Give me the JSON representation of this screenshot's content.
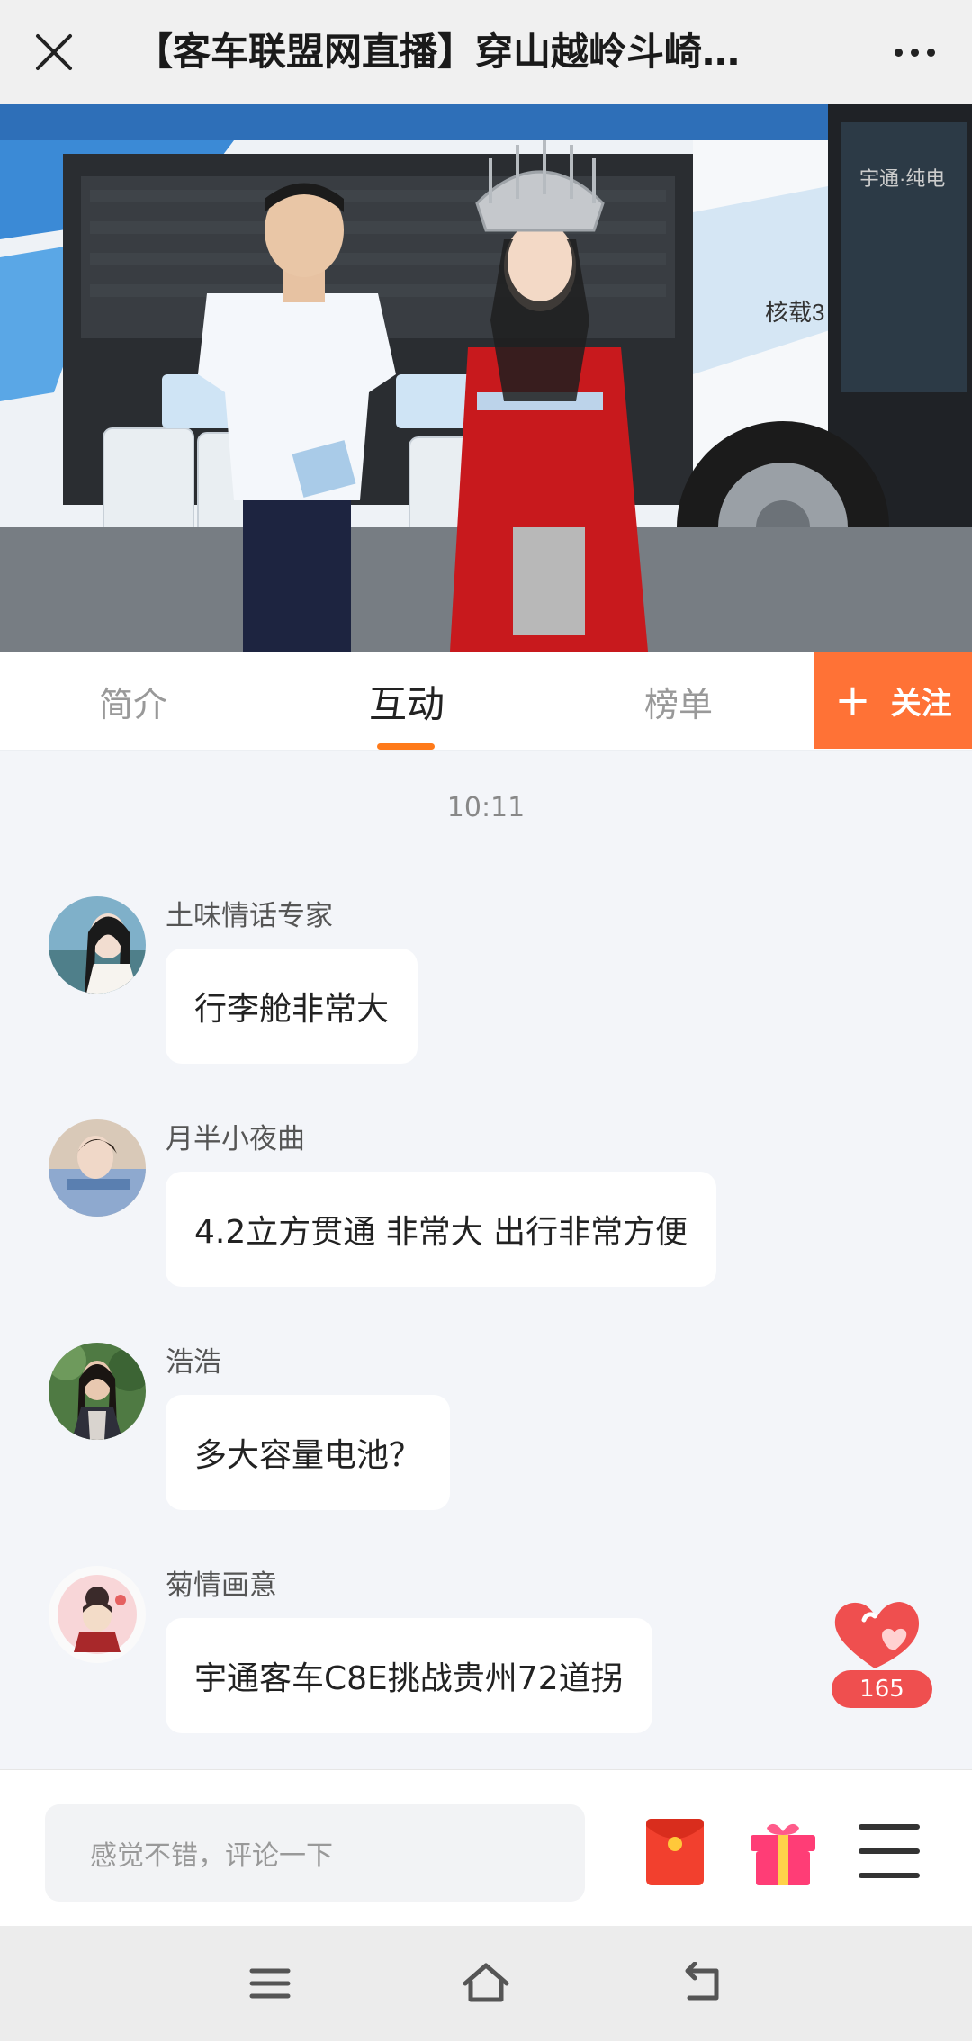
{
  "header": {
    "title": "【客车联盟网直播】穿山越岭斗崎…"
  },
  "tabs": [
    {
      "label": "简介",
      "active": false
    },
    {
      "label": "互动",
      "active": true
    },
    {
      "label": "榜单",
      "active": false
    }
  ],
  "follow_button": {
    "label": "关注",
    "color": "#ff7236"
  },
  "accent_color": "#ff7a1a",
  "chat": {
    "time": "10:11",
    "messages": [
      {
        "user": "土味情话专家",
        "text": "行李舱非常大",
        "avatar": "avatar-photo-woman"
      },
      {
        "user": "月半小夜曲",
        "text": "4.2立方贯通  非常大  出行非常方便",
        "avatar": "avatar-photo-woman"
      },
      {
        "user": "浩浩",
        "text": "多大容量电池？",
        "avatar": "avatar-photo-woman"
      },
      {
        "user": "菊情画意",
        "text": "宇通客车C8E挑战贵州72道拐",
        "avatar": "avatar-illustration"
      }
    ]
  },
  "likes": {
    "count": "165",
    "icon": "heart-icon"
  },
  "comment_bar": {
    "placeholder": "感觉不错，评论一下",
    "icons": [
      "red-packet-icon",
      "gift-icon",
      "menu-icon"
    ]
  },
  "video": {
    "bus_text": "核载3",
    "bus_brand": "宇通·纯电"
  },
  "system_nav": {
    "icons": [
      "recent-apps-icon",
      "home-icon",
      "back-icon"
    ]
  }
}
